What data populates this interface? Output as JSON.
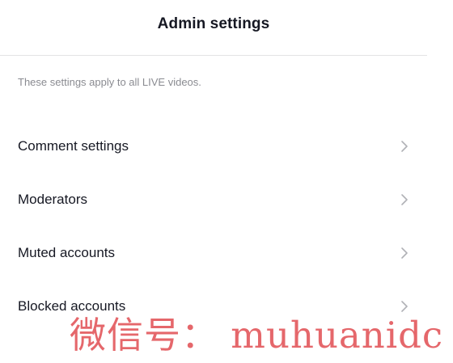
{
  "header": {
    "title": "Admin settings"
  },
  "main": {
    "subtitle": "These settings apply to all LIVE videos.",
    "items": [
      {
        "label": "Comment settings",
        "icon": "chevron-right-icon"
      },
      {
        "label": "Moderators",
        "icon": "chevron-right-icon"
      },
      {
        "label": "Muted accounts",
        "icon": "chevron-right-icon"
      },
      {
        "label": "Blocked accounts",
        "icon": "chevron-right-icon"
      }
    ]
  },
  "watermark": {
    "text": "微信号： muhuanidc"
  },
  "colors": {
    "text_primary": "#161823",
    "text_secondary": "#8a8b91",
    "divider": "#e3e3e4",
    "chevron": "#b0b1b6",
    "watermark": "#e35b5f"
  }
}
